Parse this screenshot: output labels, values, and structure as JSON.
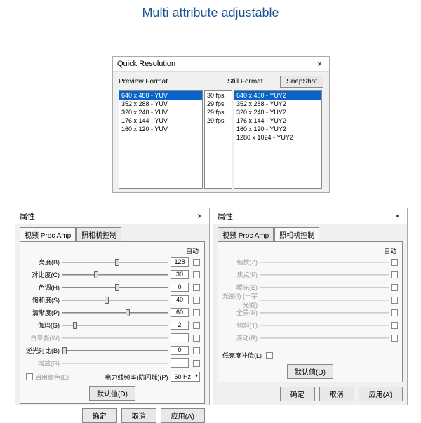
{
  "page_title": "Multi attribute adjustable",
  "qr": {
    "title": "Quick Resolution",
    "preview_label": "Preview Format",
    "still_label": "Still Format",
    "snapshot": "SnapShot",
    "preview_items": [
      "640 x 480 - YUV",
      "352 x 288 - YUV",
      "320 x 240 - YUV",
      "176 x 144 - YUV",
      "160 x 120 - YUV"
    ],
    "fps_items": [
      "30 fps",
      "29 fps",
      "29 fps",
      "29 fps"
    ],
    "still_items": [
      "640 x 480 - YUY2",
      "352 x 288 - YUY2",
      "320 x 240 - YUY2",
      "176 x 144 - YUY2",
      "160 x 120 - YUY2",
      "1280 x 1024 - YUY2"
    ]
  },
  "prop": {
    "title": "属性",
    "tab_proc": "视频 Proc Amp",
    "tab_cam": "照相机控制",
    "auto": "自动",
    "ok": "确定",
    "cancel": "取消",
    "apply": "应用(A)",
    "default": "默认值(D)",
    "enable_color": "启用颜色(E)",
    "powerline": "电力线频率(防闪烁)(P)",
    "powerline_val": "60 Hz",
    "low_comp": "低亮度补偿(L)"
  },
  "left_sliders": [
    {
      "label": "亮度(B)",
      "val": "128",
      "pos": 50,
      "en": true
    },
    {
      "label": "对比度(C)",
      "val": "30",
      "pos": 30,
      "en": true
    },
    {
      "label": "色调(H)",
      "val": "0",
      "pos": 50,
      "en": true
    },
    {
      "label": "饱和度(S)",
      "val": "40",
      "pos": 40,
      "en": true
    },
    {
      "label": "清晰度(P)",
      "val": "60",
      "pos": 60,
      "en": true
    },
    {
      "label": "伽玛(G)",
      "val": "2",
      "pos": 10,
      "en": true
    },
    {
      "label": "白平衡(W)",
      "val": "",
      "pos": 0,
      "en": false
    },
    {
      "label": "逆光对比(B)",
      "val": "0",
      "pos": 0,
      "en": true
    },
    {
      "label": "增益(G)",
      "val": "",
      "pos": 0,
      "en": false
    }
  ],
  "right_sliders": [
    {
      "label": "缩放(Z)",
      "pos": 0,
      "en": false
    },
    {
      "label": "焦点(F)",
      "pos": 0,
      "en": false
    },
    {
      "label": "曝光(E)",
      "pos": 0,
      "en": false
    },
    {
      "label": "光圈(I)\n(十字光圈)",
      "pos": 0,
      "en": false
    },
    {
      "label": "全景(P)",
      "pos": 0,
      "en": false
    },
    {
      "label": "倾斜(T)",
      "pos": 0,
      "en": false
    },
    {
      "label": "滚动(R)",
      "pos": 0,
      "en": false
    }
  ]
}
